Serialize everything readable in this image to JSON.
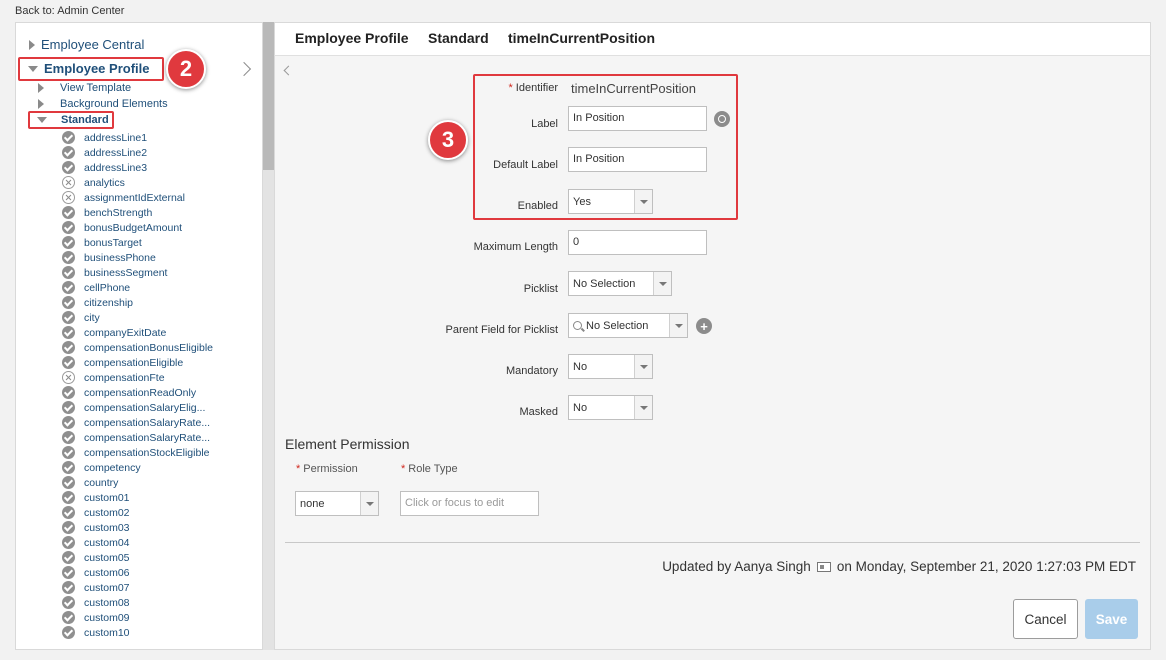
{
  "back_link": "Back to: Admin Center",
  "tree": {
    "employee_central": "Employee Central",
    "employee_profile": "Employee Profile",
    "view_template": "View Template",
    "background_elements": "Background Elements",
    "standard": "Standard",
    "items": [
      {
        "label": "addressLine1",
        "status": "check"
      },
      {
        "label": "addressLine2",
        "status": "check"
      },
      {
        "label": "addressLine3",
        "status": "check"
      },
      {
        "label": "analytics",
        "status": "x"
      },
      {
        "label": "assignmentIdExternal",
        "status": "x"
      },
      {
        "label": "benchStrength",
        "status": "check"
      },
      {
        "label": "bonusBudgetAmount",
        "status": "check"
      },
      {
        "label": "bonusTarget",
        "status": "check"
      },
      {
        "label": "businessPhone",
        "status": "check"
      },
      {
        "label": "businessSegment",
        "status": "check"
      },
      {
        "label": "cellPhone",
        "status": "check"
      },
      {
        "label": "citizenship",
        "status": "check"
      },
      {
        "label": "city",
        "status": "check"
      },
      {
        "label": "companyExitDate",
        "status": "check"
      },
      {
        "label": "compensationBonusEligible",
        "status": "check"
      },
      {
        "label": "compensationEligible",
        "status": "check"
      },
      {
        "label": "compensationFte",
        "status": "x"
      },
      {
        "label": "compensationReadOnly",
        "status": "check"
      },
      {
        "label": "compensationSalaryElig...",
        "status": "check"
      },
      {
        "label": "compensationSalaryRate...",
        "status": "check"
      },
      {
        "label": "compensationSalaryRate...",
        "status": "check"
      },
      {
        "label": "compensationStockEligible",
        "status": "check"
      },
      {
        "label": "competency",
        "status": "check"
      },
      {
        "label": "country",
        "status": "check"
      },
      {
        "label": "custom01",
        "status": "check"
      },
      {
        "label": "custom02",
        "status": "check"
      },
      {
        "label": "custom03",
        "status": "check"
      },
      {
        "label": "custom04",
        "status": "check"
      },
      {
        "label": "custom05",
        "status": "check"
      },
      {
        "label": "custom06",
        "status": "check"
      },
      {
        "label": "custom07",
        "status": "check"
      },
      {
        "label": "custom08",
        "status": "check"
      },
      {
        "label": "custom09",
        "status": "check"
      },
      {
        "label": "custom10",
        "status": "check"
      }
    ]
  },
  "badges": {
    "two": "2",
    "three": "3"
  },
  "header": {
    "crumb1": "Employee Profile",
    "crumb2": "Standard",
    "crumb3": "timeInCurrentPosition"
  },
  "form": {
    "identifier_label": "Identifier",
    "identifier_value": "timeInCurrentPosition",
    "label_label": "Label",
    "label_value": "In Position",
    "default_label_label": "Default Label",
    "default_label_value": "In Position",
    "enabled_label": "Enabled",
    "enabled_value": "Yes",
    "max_length_label": "Maximum Length",
    "max_length_value": "0",
    "picklist_label": "Picklist",
    "picklist_value": "No Selection",
    "parent_field_label": "Parent Field for Picklist",
    "parent_field_value": "No Selection",
    "mandatory_label": "Mandatory",
    "mandatory_value": "No",
    "masked_label": "Masked",
    "masked_value": "No",
    "required_marker": "*"
  },
  "permission": {
    "title": "Element Permission",
    "permission_label": "Permission",
    "role_type_label": "Role Type",
    "permission_value": "none",
    "role_type_placeholder": "Click or focus to edit"
  },
  "footer": {
    "updated_prefix": "Updated by Aanya Singh",
    "updated_suffix": "on Monday, September 21, 2020 1:27:03 PM EDT",
    "cancel": "Cancel",
    "save": "Save"
  },
  "colors": {
    "highlight_red": "#e0393e",
    "tree_link": "#1f4f79",
    "save_disabled": "#a9cdea"
  }
}
